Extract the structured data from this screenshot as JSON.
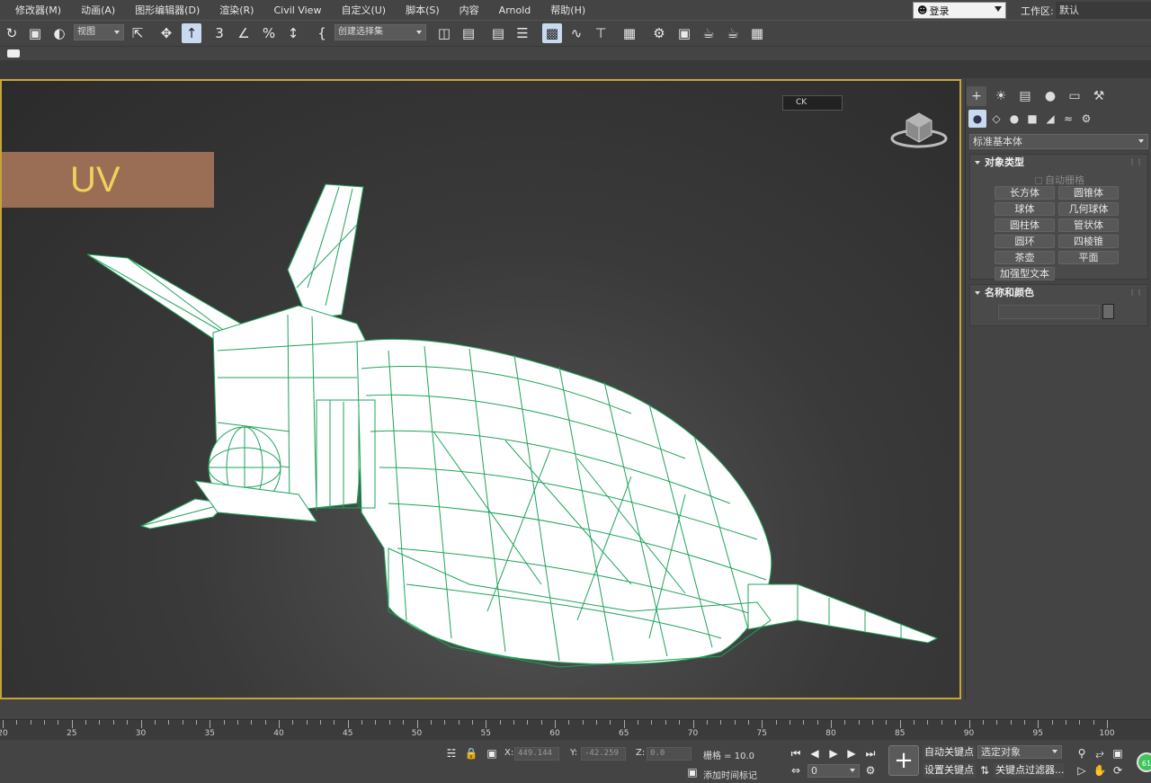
{
  "menu": [
    "修改器(M)",
    "动画(A)",
    "图形编辑器(D)",
    "渲染(R)",
    "Civil View",
    "自定义(U)",
    "脚本(S)",
    "内容",
    "Arnold",
    "帮助(H)"
  ],
  "login": {
    "label": "登录",
    "icon": "user-icon"
  },
  "workspace": {
    "label": "工作区:",
    "value": "默认"
  },
  "toolbar": {
    "view_select": "视图",
    "selection_set_placeholder": "创建选择集",
    "icons": [
      "redo-icon",
      "select-region-icon",
      "window-crossing-icon",
      "select-and-link-icon",
      "move-icon",
      "select-object-icon",
      "snap-3d-icon",
      "angle-snap-icon",
      "percent-snap-icon",
      "spinner-snap-icon",
      "edit-named-selection-icon",
      "mirror-icon",
      "align-icon",
      "scene-explorer-icon",
      "layer-explorer-icon",
      "toggle-ribbon-icon",
      "curve-editor-icon",
      "schematic-view-icon",
      "material-editor-icon",
      "render-setup-icon",
      "rendered-frame-icon",
      "render-production-icon",
      "render-iterative-icon",
      "a360-icon"
    ]
  },
  "viewport": {
    "overlay_label": "UV",
    "camera_widget": "CK",
    "border_color": "#c8a33a",
    "wire_color": "#1fa35a"
  },
  "command_panel": {
    "tabs": [
      "create-tab-icon",
      "modify-tab-icon",
      "hierarchy-tab-icon",
      "motion-tab-icon",
      "display-tab-icon",
      "utilities-tab-icon"
    ],
    "subtabs": [
      "geometry-icon",
      "shapes-icon",
      "lights-icon",
      "cameras-icon",
      "helpers-icon",
      "space-warps-icon",
      "systems-icon"
    ],
    "category": "标准基本体",
    "object_type": {
      "title": "对象类型",
      "autogrid": "自动栅格",
      "buttons": [
        "长方体",
        "圆锥体",
        "球体",
        "几何球体",
        "圆柱体",
        "管状体",
        "圆环",
        "四棱锥",
        "茶壶",
        "平面",
        "加强型文本"
      ]
    },
    "name_color": {
      "title": "名称和颜色",
      "name": ""
    }
  },
  "timeline": {
    "ticks": [
      20,
      25,
      30,
      35,
      40,
      45,
      50,
      55,
      60,
      65,
      70,
      75,
      80,
      85,
      90,
      95,
      100
    ]
  },
  "status": {
    "x_label": "X:",
    "x_value": "449.144",
    "y_label": "Y:",
    "y_value": "-42.259",
    "z_label": "Z:",
    "z_value": "0.0",
    "grid": "栅格 = 10.0",
    "add_time_tag": "添加时间标记",
    "auto_key": "自动关键点",
    "set_key": "设置关键点",
    "selected_object": "选定对象",
    "key_filters": "关键点过滤器...",
    "frame": "0",
    "badge": "61"
  }
}
